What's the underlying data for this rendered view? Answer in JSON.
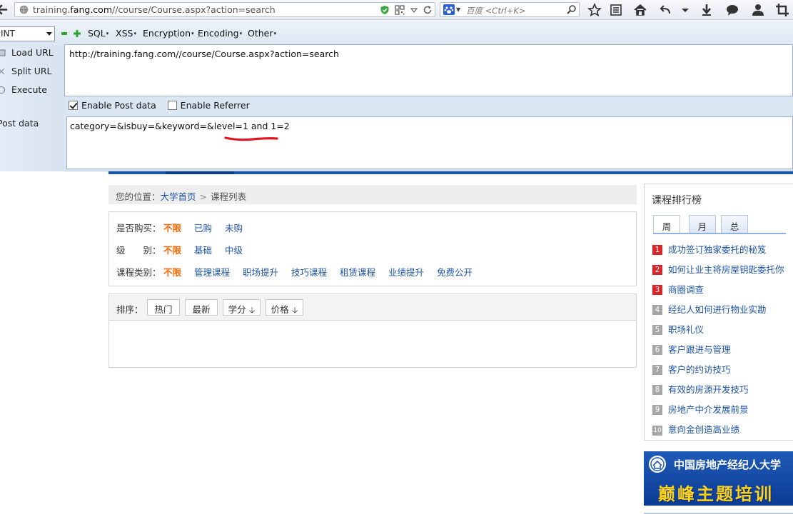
{
  "browser": {
    "url_prefix": "training.",
    "url_host": "fang.com",
    "url_path": "//course/Course.aspx?action=search",
    "search_placeholder": "百度 <Ctrl+K>"
  },
  "hackbar": {
    "select_value": "INT",
    "menus": [
      "SQL",
      "XSS",
      "Encryption",
      "Encoding",
      "Other"
    ],
    "side_buttons": {
      "load_url": "Load URL",
      "split_url": "Split URL",
      "execute": "Execute",
      "post_data": "Post data"
    },
    "url_value": "http://training.fang.com//course/Course.aspx?action=search",
    "enable_post_label": "Enable Post data",
    "enable_post_checked": true,
    "enable_referrer_label": "Enable Referrer",
    "enable_referrer_checked": false,
    "post_value": "category=&isbuy=&keyword=&level=1 and 1=2"
  },
  "page": {
    "breadcrumb": {
      "prefix": "您的位置：",
      "home": "大学首页",
      "sep": ">",
      "current": "课程列表"
    },
    "filters": [
      {
        "label": "是否购买：",
        "options": [
          "不限",
          "已购",
          "未购"
        ],
        "selected": 0
      },
      {
        "label": "级　　别：",
        "options": [
          "不限",
          "基础",
          "中级"
        ],
        "selected": 0
      },
      {
        "label": "课程类别：",
        "options": [
          "不限",
          "管理课程",
          "职场提升",
          "技巧课程",
          "租赁课程",
          "业绩提升",
          "免费公开"
        ],
        "selected": 0
      }
    ],
    "sort": {
      "label": "排序：",
      "buttons": [
        "热门",
        "最新",
        "学分",
        "价格"
      ]
    }
  },
  "sidebar": {
    "title": "课程排行榜",
    "tabs": [
      "周",
      "月",
      "总"
    ],
    "active_tab": 0,
    "items": [
      {
        "num": "1",
        "text": "成功签订独家委托的秘笈"
      },
      {
        "num": "2",
        "text": "如何让业主将房屋钥匙委托你"
      },
      {
        "num": "3",
        "text": "商圈调查"
      },
      {
        "num": "4",
        "text": "经纪人如何进行物业实勘"
      },
      {
        "num": "5",
        "text": "职场礼仪"
      },
      {
        "num": "6",
        "text": "客户跟进与管理"
      },
      {
        "num": "7",
        "text": "客户的约访技巧"
      },
      {
        "num": "8",
        "text": "有效的房源开发技巧"
      },
      {
        "num": "9",
        "text": "房地产中介发展前景"
      },
      {
        "num": "10",
        "text": "意向金创造高业绩"
      }
    ],
    "banner_title": "中国房地产经纪人大学",
    "banner_subtitle": "巅峰主题培训"
  },
  "colors": {
    "link": "#1d55a8",
    "selected": "#ff6600",
    "rank_hot": "#d7262b",
    "rank_norm": "#a6a6a6",
    "annotation": "#e0141e"
  }
}
